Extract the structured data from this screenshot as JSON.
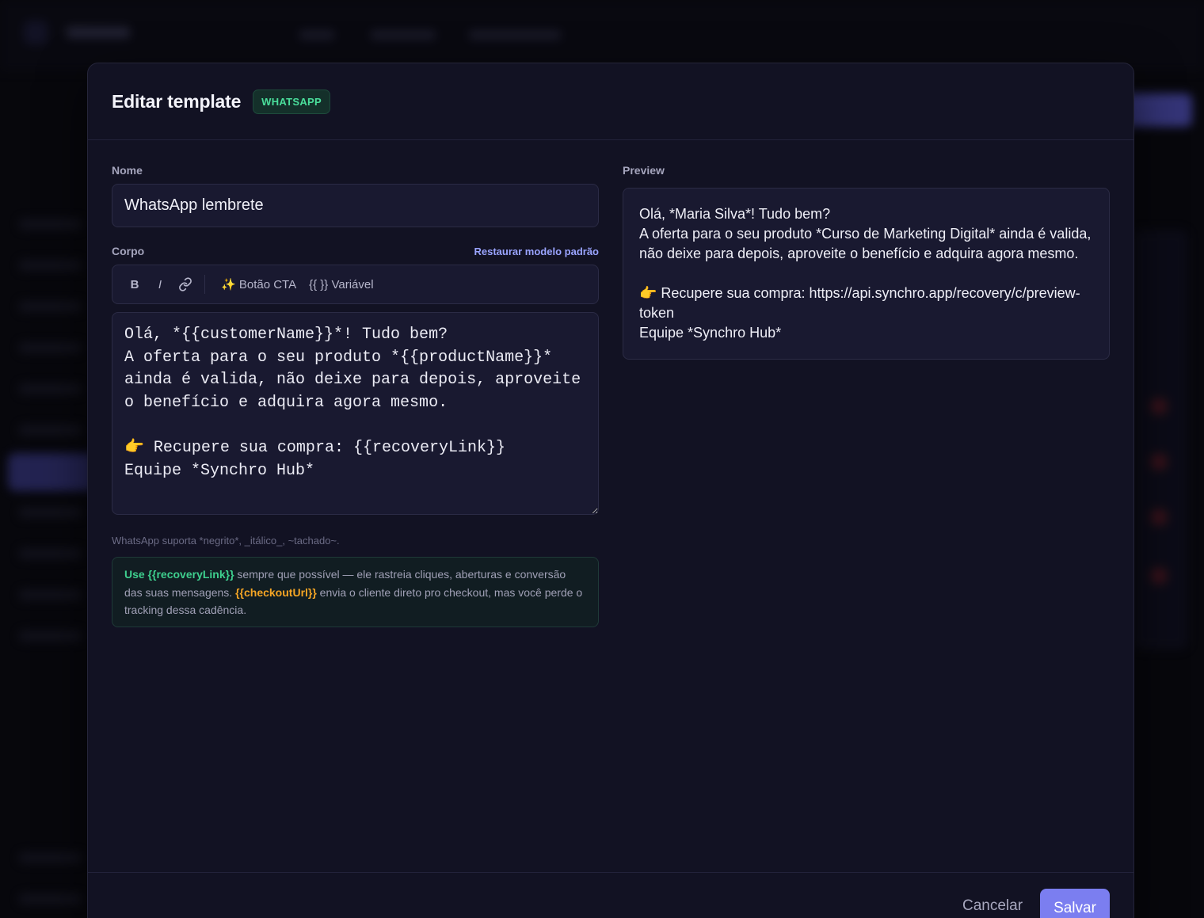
{
  "modal": {
    "title": "Editar template",
    "channel_badge": "WHATSAPP"
  },
  "form": {
    "name_label": "Nome",
    "name_value": "WhatsApp lembrete",
    "body_label": "Corpo",
    "restore_label": "Restaurar modelo padrão",
    "toolbar": {
      "bold_label": "B",
      "italic_label": "I",
      "link_icon": "link-icon",
      "cta_label": "✨ Botão CTA",
      "variable_label": "{{ }} Variável"
    },
    "body_value": "Olá, *{{customerName}}*! Tudo bem?\nA oferta para o seu produto *{{productName}}* ainda é valida, não deixe para depois, aproveite o benefício e adquira agora mesmo.\n\n👉 Recupere sua compra: {{recoveryLink}}\nEquipe *Synchro Hub*",
    "format_hint": "WhatsApp suporta *negrito*, _itálico_, ~tachado~.",
    "info": {
      "use_word": "Use",
      "recovery_var": "{{recoveryLink}}",
      "text_1": " sempre que possível — ele rastreia cliques, aberturas e conversão das suas mensagens. ",
      "checkout_var": "{{checkoutUrl}}",
      "text_2": " envia o cliente direto pro checkout, mas você perde o tracking dessa cadência."
    }
  },
  "preview": {
    "label": "Preview",
    "text": "Olá, *Maria Silva*! Tudo bem?\nA oferta para o seu produto *Curso de Marketing Digital* ainda é valida, não deixe para depois, aproveite o benefício e adquira agora mesmo.\n\n👉 Recupere sua compra: https://api.synchro.app/recovery/c/preview-token\nEquipe *Synchro Hub*"
  },
  "footer": {
    "cancel_label": "Cancelar",
    "save_label": "Salvar"
  },
  "colors": {
    "accent": "#7b7ef0",
    "badge_green": "#4ade9b",
    "var_green": "#3ecf8e",
    "var_amber": "#f5a524"
  }
}
